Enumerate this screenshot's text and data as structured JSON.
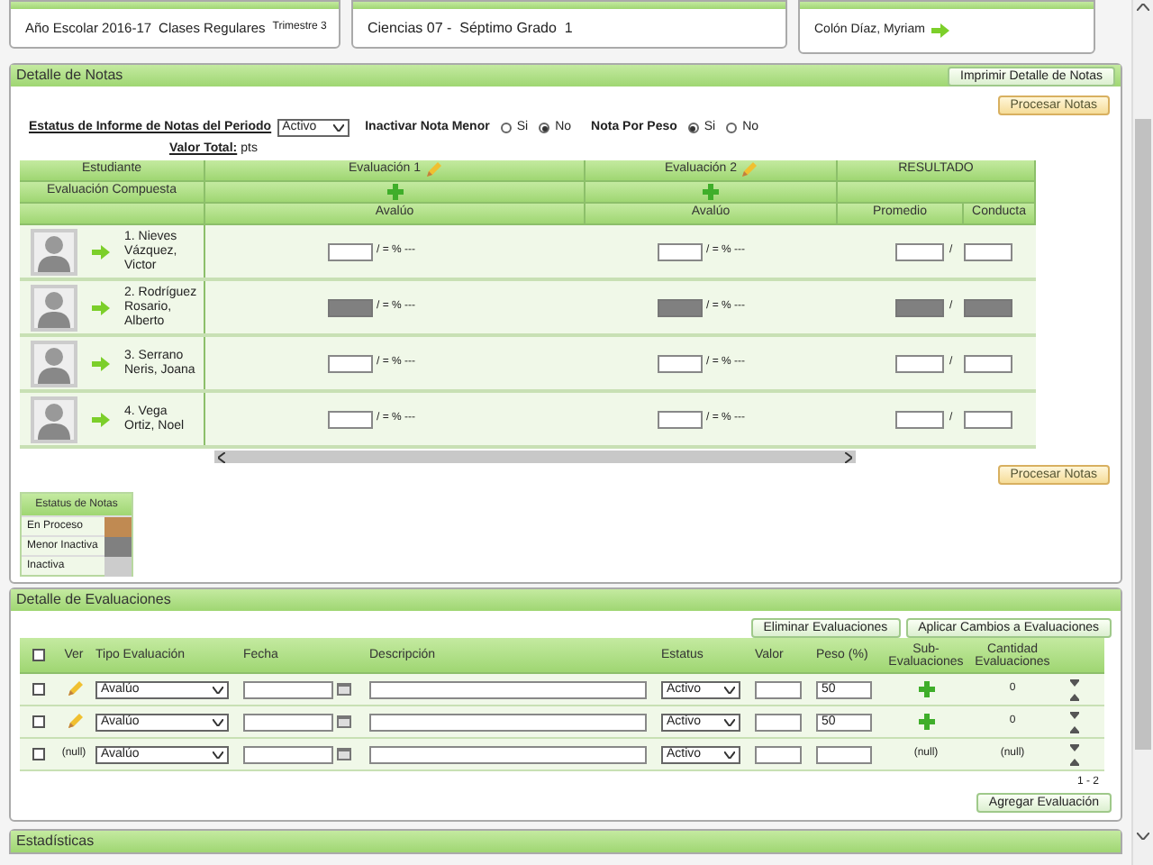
{
  "top_panels": {
    "calendar": {
      "year": "Año Escolar 2016-17",
      "type": "Clases Regulares",
      "term": "Trimestre 3"
    },
    "class": {
      "text": "Ciencias 07 -  Séptimo Grado  1"
    },
    "teacher": {
      "name": "Colón Díaz, Myriam"
    }
  },
  "notes_panel": {
    "title": "Detalle de Notas",
    "print_button": "Imprimir Detalle de Notas",
    "process_button": "Procesar Notas",
    "status_label": "Estatus de Informe de Notas del Periodo",
    "status_value": "Activo",
    "inactivate_label": "Inactivar Nota Menor",
    "inactivate_options": [
      {
        "label": "Si",
        "selected": false
      },
      {
        "label": "No",
        "selected": true
      }
    ],
    "weight_label": "Nota Por Peso",
    "weight_options": [
      {
        "label": "Si",
        "selected": true
      },
      {
        "label": "No",
        "selected": false
      }
    ],
    "total_label": "Valor Total:",
    "total_unit": "pts",
    "table": {
      "student_header": "Estudiante",
      "composite_header": "Evaluación Compuesta",
      "result_header": "RESULTADO",
      "evaluations": [
        {
          "title": "Evaluación 1",
          "type": "Avalúo"
        },
        {
          "title": "Evaluación 2",
          "type": "Avalúo"
        }
      ],
      "average_header": "Promedio",
      "conduct_header": "Conducta",
      "rows": [
        {
          "name": "1. Nieves Vázquez, Victor",
          "inactive": false,
          "grades": [
            "/ = % ---",
            "/ = % ---"
          ],
          "average_sep": "/"
        },
        {
          "name": "2. Rodríguez Rosario, Alberto",
          "inactive": true,
          "grades": [
            "/ = % ---",
            "/ = % ---"
          ],
          "average_sep": "/"
        },
        {
          "name": "3. Serrano Neris, Joana",
          "inactive": false,
          "grades": [
            "/ = % ---",
            "/ = % ---"
          ],
          "average_sep": "/"
        },
        {
          "name": "4. Vega Ortiz, Noel",
          "inactive": false,
          "grades": [
            "/ = % ---",
            "/ = % ---"
          ],
          "average_sep": "/"
        }
      ]
    },
    "process_button_bottom": "Procesar Notas",
    "legend": {
      "title": "Estatus de Notas",
      "items": [
        {
          "label": "En Proceso",
          "color": "#c08a52"
        },
        {
          "label": "Menor Inactiva",
          "color": "#808080"
        },
        {
          "label": "Inactiva",
          "color": "#cccccc"
        }
      ]
    }
  },
  "evaluations_panel": {
    "title": "Detalle de Evaluaciones",
    "buttons": [
      "Eliminar Evaluaciones",
      "Aplicar Cambios a Evaluaciones"
    ],
    "columns": [
      "Ver",
      "Tipo Evaluación",
      "Fecha",
      "Descripción",
      "Estatus",
      "Valor",
      "Peso (%)",
      "Sub-Evaluaciones",
      "Cantidad Evaluaciones"
    ],
    "all_checked": false,
    "rows": [
      {
        "kind": "saved",
        "checked": false,
        "type": "Avalúo",
        "status": "Activo",
        "weight": "50",
        "count": "0"
      },
      {
        "kind": "saved",
        "checked": false,
        "type": "Avalúo",
        "status": "Activo",
        "weight": "50",
        "count": "0"
      },
      {
        "kind": "new",
        "checked": false,
        "view": "(null)",
        "type": "Avalúo",
        "status": "Activo",
        "sub": "(null)",
        "count": "(null)"
      }
    ],
    "pager": "1 - 2",
    "add_button": "Agregar Evaluación"
  },
  "stats_panel": {
    "title": "Estadísticas"
  }
}
